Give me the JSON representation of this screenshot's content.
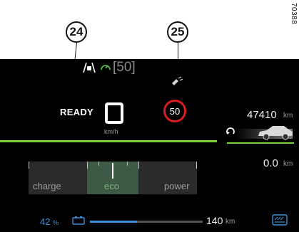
{
  "callouts": {
    "left": "24",
    "right": "25"
  },
  "ref_number": "70388",
  "assist": {
    "bracket_speed": "[50]"
  },
  "status": {
    "ready": "READY"
  },
  "speed": {
    "unit": "km/h"
  },
  "speed_limit": {
    "value": "50"
  },
  "odometer": {
    "value": "47410",
    "unit": "km"
  },
  "trip": {
    "value": "0.0",
    "unit": "km"
  },
  "power_gauge": {
    "labels": [
      "charge",
      "eco",
      "power"
    ],
    "active": "eco"
  },
  "battery": {
    "percent": "42",
    "percent_unit": "%",
    "level": 0.42
  },
  "range": {
    "value": "140",
    "unit": "km"
  },
  "colors": {
    "accent_green": "#7fd33a",
    "limit_red": "#d81e1e",
    "range_blue": "#3a8fd8",
    "eco_green": "#3e5a45"
  },
  "icons": {
    "assist": "car-lane-assist-icon",
    "timer": "cruise-timer-icon",
    "sign_recognition": "satellite-sign-icon",
    "trip": "trip-reset-icon",
    "car": "car-silhouette-icon",
    "battery": "battery-icon",
    "drive_mode": "drive-mode-icon"
  }
}
